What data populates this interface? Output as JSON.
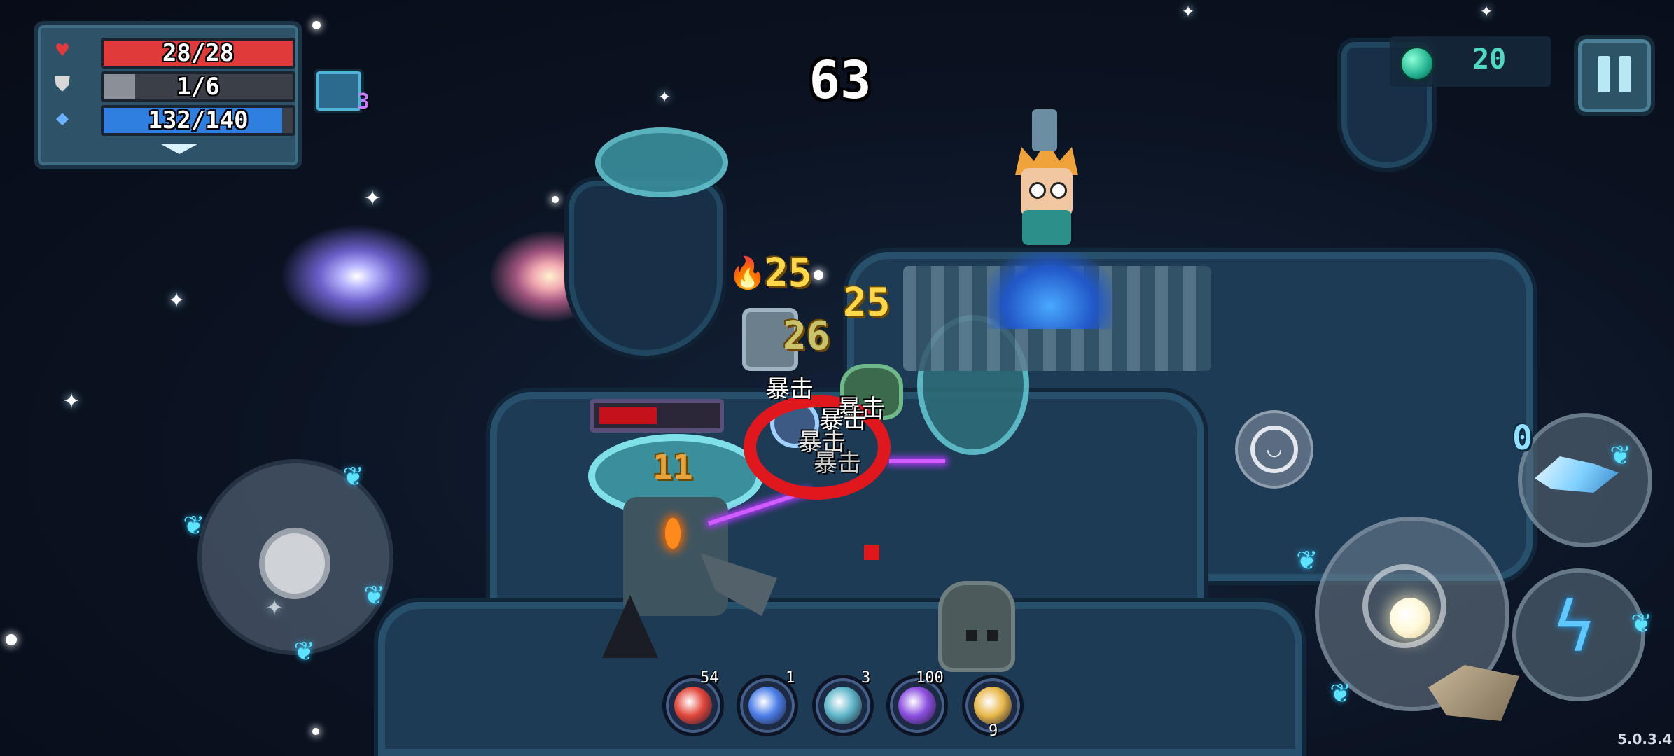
{
  "hud": {
    "health": {
      "icon": "heart-icon",
      "text": "28/28",
      "current": 28,
      "max": 28,
      "color": "#e03a3a"
    },
    "armor": {
      "icon": "shield-icon",
      "text": "1/6",
      "current": 1,
      "max": 6,
      "color": "#8a8f98"
    },
    "energy": {
      "icon": "diamond-icon",
      "text": "132/140",
      "current": 132,
      "max": 140,
      "color": "#2f7fe0"
    },
    "buff_stack": "3",
    "timer": "63"
  },
  "currency": {
    "icon": "gem-icon",
    "amount": "20"
  },
  "combat": {
    "damage_numbers": [
      "25",
      "25",
      "26",
      "11"
    ],
    "crit_labels": [
      "暴击",
      "暴击",
      "暴击",
      "暴击",
      "暴击"
    ],
    "enemy_hp_fraction": 0.5
  },
  "controls": {
    "weapon_energy_cost": "0"
  },
  "buff_bar": [
    {
      "icon": "red-orb-buff-icon",
      "count": "54",
      "color": "#e2463a"
    },
    {
      "icon": "crystal-buff-icon",
      "count": "1",
      "color": "#4c7fe8"
    },
    {
      "icon": "ghost-sword-buff-icon",
      "count": "3",
      "color": "#5fb6c9"
    },
    {
      "icon": "purple-spirit-buff-icon",
      "count": "100",
      "color": "#8c4fe0"
    },
    {
      "icon": "golden-fist-buff-icon",
      "count": "9",
      "color": "#e8b84a"
    }
  ],
  "version": "5.0.3.4"
}
